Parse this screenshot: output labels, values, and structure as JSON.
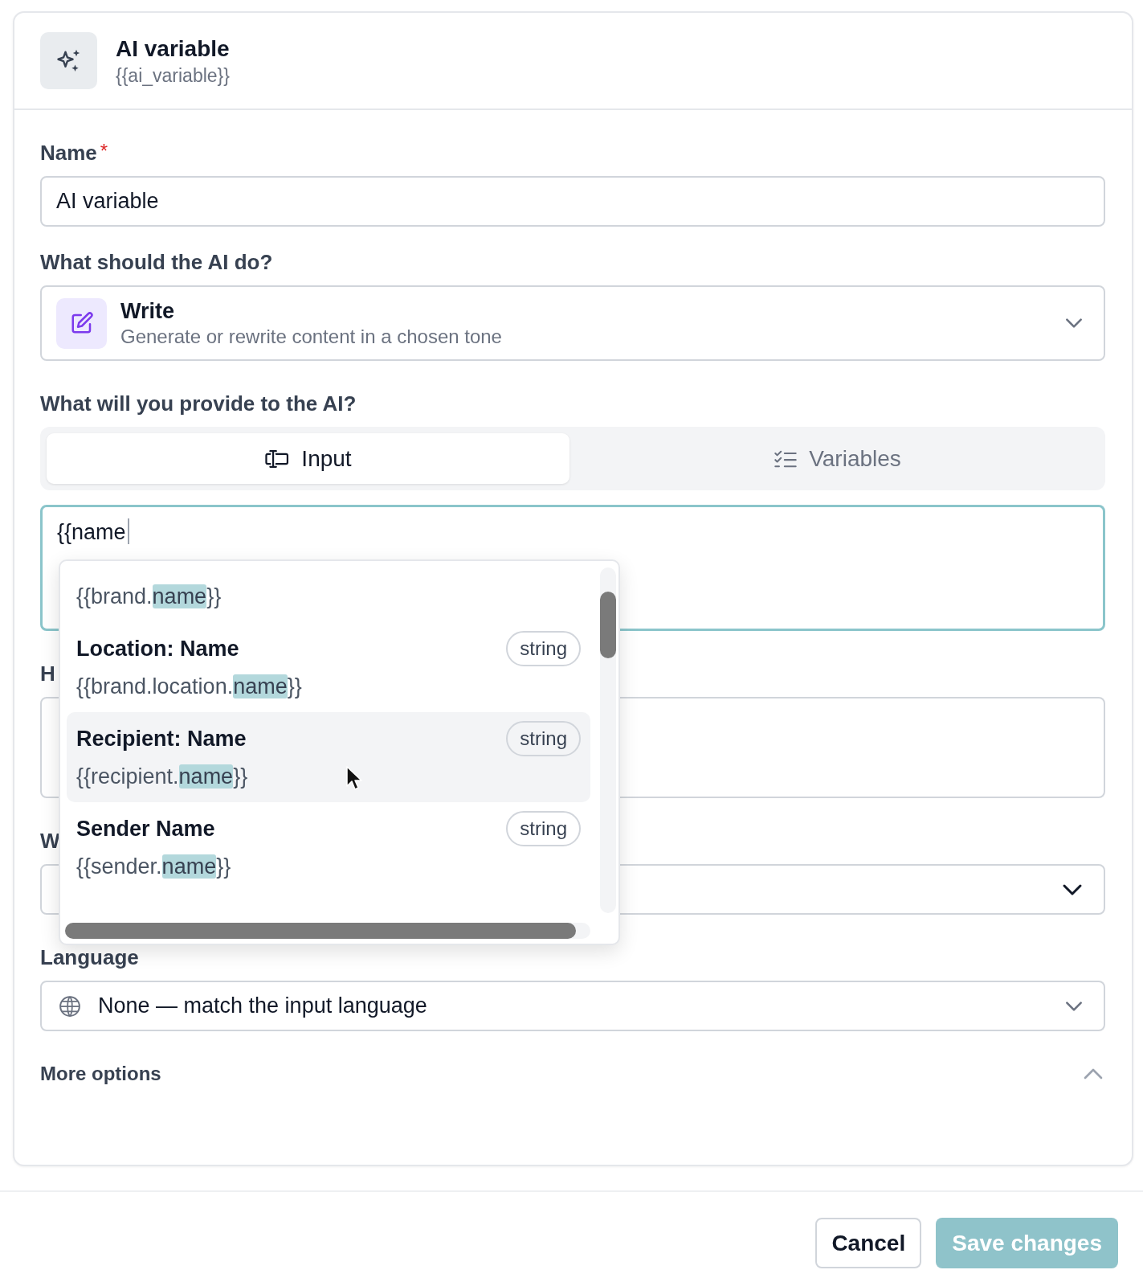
{
  "header": {
    "title": "AI variable",
    "token": "{{ai_variable}}"
  },
  "name_field": {
    "label": "Name",
    "required_mark": "*",
    "value": "AI variable"
  },
  "task_select": {
    "label": "What should the AI do?",
    "title": "Write",
    "description": "Generate or rewrite content in a chosen tone"
  },
  "provide": {
    "label": "What will you provide to the AI?",
    "tabs": [
      {
        "label": "Input",
        "kind": "input",
        "selected": true
      },
      {
        "label": "Variables",
        "kind": "variables",
        "selected": false
      }
    ],
    "input": {
      "value": "{{name",
      "focused": true
    },
    "suggestions": [
      {
        "path": {
          "before": "{{brand.",
          "match": "name",
          "after": "}}"
        },
        "selected": false
      },
      {
        "title": "Location: Name",
        "path": {
          "before": "{{brand.location.",
          "match": "name",
          "after": "}}"
        },
        "type": "string",
        "selected": false
      },
      {
        "title": "Recipient: Name",
        "path": {
          "before": "{{recipient.",
          "match": "name",
          "after": "}}"
        },
        "type": "string",
        "selected": true
      },
      {
        "title": "Sender Name",
        "path": {
          "before": "{{sender.",
          "match": "name",
          "after": "}}"
        },
        "type": "string",
        "selected": false
      }
    ]
  },
  "covered_textarea": {
    "label": "H"
  },
  "covered_select": {
    "label": "W"
  },
  "language": {
    "label": "Language",
    "value": "None — match the input language"
  },
  "more_options": {
    "label": "More options",
    "expanded": true
  },
  "buttons": [
    {
      "label": "Cancel",
      "kind": "secondary",
      "disabled": false
    },
    {
      "label": "Save changes",
      "kind": "primary",
      "disabled": true
    }
  ]
}
